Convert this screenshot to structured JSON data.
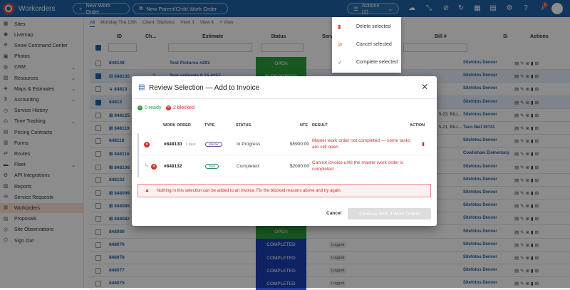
{
  "app": {
    "title": "Workorders"
  },
  "header": {
    "new_work_order": "New Work Order",
    "new_parent_child": "New Parent/Child Work Order",
    "actions_label": "Actions (2)",
    "notif_count": "5"
  },
  "sidebar": {
    "items": [
      {
        "label": "Sites",
        "icon": "building-icon",
        "chev": ""
      },
      {
        "label": "Livemap",
        "icon": "map-icon",
        "chev": ""
      },
      {
        "label": "Snow Command Center",
        "icon": "snowflake-icon",
        "chev": ""
      },
      {
        "label": "Photos",
        "icon": "photo-icon",
        "chev": ""
      },
      {
        "label": "CRM",
        "icon": "people-icon",
        "chev": "⌄"
      },
      {
        "label": "Resources",
        "icon": "box-icon",
        "chev": "⌄"
      },
      {
        "label": "Maps & Estimates",
        "icon": "map-pin-icon",
        "chev": "⌄"
      },
      {
        "label": "Accounting",
        "icon": "dollar-icon",
        "chev": "⌄"
      },
      {
        "label": "Service History",
        "icon": "history-icon",
        "chev": ""
      },
      {
        "label": "Time Tracking",
        "icon": "clock-icon",
        "chev": "⌄"
      },
      {
        "label": "Pricing Contracts",
        "icon": "contract-icon",
        "chev": ""
      },
      {
        "label": "Forms",
        "icon": "form-icon",
        "chev": ""
      },
      {
        "label": "Routes",
        "icon": "route-icon",
        "chev": ""
      },
      {
        "label": "Fleet",
        "icon": "truck-icon",
        "chev": "⌄"
      },
      {
        "label": "API Integrations",
        "icon": "api-icon",
        "chev": ""
      },
      {
        "label": "Reports",
        "icon": "report-icon",
        "chev": ""
      },
      {
        "label": "Service Requests",
        "icon": "request-icon",
        "chev": ""
      },
      {
        "label": "Workorders",
        "icon": "workorder-icon",
        "chev": "",
        "active": true
      },
      {
        "label": "Proposals",
        "icon": "proposal-icon",
        "chev": ""
      },
      {
        "label": "Site Observations",
        "icon": "observation-icon",
        "chev": ""
      },
      {
        "label": "Sign Out",
        "icon": "signout-icon",
        "chev": ""
      }
    ]
  },
  "viewtabs": [
    "All",
    "Monday The 13th",
    "Client: Sitefotos",
    "View 3",
    "View 4",
    "+ View"
  ],
  "table": {
    "headers": {
      "id": "ID",
      "ch": "Ch...",
      "estimate": "Estimate",
      "status": "Status",
      "serv": "Serv",
      "bill": "Bill #",
      "site": "Si",
      "actions": "Actions"
    },
    "rows": [
      {
        "id": "848148",
        "sel": false,
        "status": "OPEN",
        "status_color": "#2e9e3f",
        "estimate": "Test Pictures #291",
        "site": "Sitefotos Denver"
      },
      {
        "id": "⊟ 848130",
        "sel": true,
        "ch": "2",
        "status": "IN PROGRESS",
        "status_color": "#2e9e3f",
        "estimate": "Test estimate 9.15 #257",
        "site": "Sitefotos Denver"
      },
      {
        "id": "↳ 84813",
        "sel": false,
        "status": "",
        "status_color": "",
        "estimate": "",
        "site": "Sitefotos Denver"
      },
      {
        "id": "84813",
        "sel": true,
        "status": "",
        "status_color": "",
        "estimate": "",
        "site": "Sitefotos Denver"
      },
      {
        "id": "⊞ 848125",
        "sel": false,
        "status": "",
        "status_color": "",
        "estimate": "",
        "site": "Sitefotos Denver",
        "bill": "5-23, BILL..."
      },
      {
        "id": "⊞ 848119",
        "sel": false,
        "status": "",
        "status_color": "",
        "estimate": "",
        "site": "Taco Bell 26741",
        "bill": "5-21, BILL..."
      },
      {
        "id": "848118",
        "sel": false,
        "status": "",
        "status_color": "",
        "estimate": "",
        "site": "Sitefotos Denver"
      },
      {
        "id": "⊞ 848116",
        "sel": false,
        "status": "",
        "status_color": "",
        "estimate": "",
        "site": "Cowlishaw Elementary"
      },
      {
        "id": "⊞ 848108",
        "sel": false,
        "status": "",
        "status_color": "",
        "estimate": "",
        "site": "Sitefotos Denver"
      },
      {
        "id": "848102",
        "sel": false,
        "status": "",
        "status_color": "",
        "estimate": "",
        "site": "Sitefotos Denver"
      },
      {
        "id": "⊞ 848099",
        "sel": false,
        "status": "",
        "status_color": "",
        "estimate": "",
        "site": "Sitefotos Denver"
      },
      {
        "id": "⊞ 848085",
        "sel": false,
        "status": "",
        "status_color": "",
        "estimate": "",
        "site": "Sitefotos Denver"
      },
      {
        "id": "⊞ 848082",
        "sel": false,
        "status": "",
        "status_color": "",
        "estimate": "",
        "site": "Sitefotos Denver"
      },
      {
        "id": "848080",
        "sel": false,
        "status": "OPEN",
        "status_color": "#2e9e3f",
        "estimate": "",
        "site": "Sitefotos Denver"
      },
      {
        "id": "848079",
        "sel": false,
        "status": "COMPLETED",
        "status_color": "#1a3fb5",
        "logged": "Logged",
        "estimate": "",
        "site": "Sitefotos Denver"
      },
      {
        "id": "848078",
        "sel": false,
        "status": "COMPLETED",
        "status_color": "#1a3fb5",
        "logged": "Logged",
        "estimate": "",
        "site": "Sitefotos Denver"
      },
      {
        "id": "848077",
        "sel": false,
        "status": "COMPLETED",
        "status_color": "#1a3fb5",
        "logged": "Logged",
        "estimate": "",
        "site": "Sitefotos Denver"
      },
      {
        "id": "848075",
        "sel": false,
        "status": "COMPLETED",
        "status_color": "#1a3fb5",
        "logged": "Logged",
        "estimate": "",
        "site": "Sitefotos Denver"
      }
    ]
  },
  "dropdown": {
    "items": [
      {
        "label": "Delete selected",
        "icon": "trash-icon",
        "color": "#e2473d"
      },
      {
        "label": "Cancel selected",
        "icon": "cancel-icon",
        "color": "#e2683d"
      },
      {
        "label": "Complete selected",
        "icon": "check-icon",
        "color": "#2e9e3f"
      }
    ]
  },
  "modal": {
    "title": "Review Selection — Add to Invoice",
    "ready": "0 ready",
    "blocked": "2 blocked",
    "columns": {
      "work_order": "WORK ORDER",
      "type": "TYPE",
      "status": "STATUS",
      "nte": "NTE",
      "result": "RESULT",
      "action": "ACTION"
    },
    "rows": [
      {
        "wo": "#848130",
        "tasks": "1 task",
        "type": "Master",
        "status": "In Progress",
        "nte": "$5900.00",
        "result": "Master work order not completed — some tasks are still open"
      },
      {
        "wo": "#848132",
        "tasks": "",
        "type": "Task",
        "status": "Completed",
        "nte": "$2000.00",
        "result": "Cannot invoice until the master work order is completed"
      }
    ],
    "alert": "Nothing in this selection can be added to an invoice. Fix the blocked reasons above and try again.",
    "cancel": "Cancel",
    "continue": "Continue With 0 Work Orders"
  }
}
